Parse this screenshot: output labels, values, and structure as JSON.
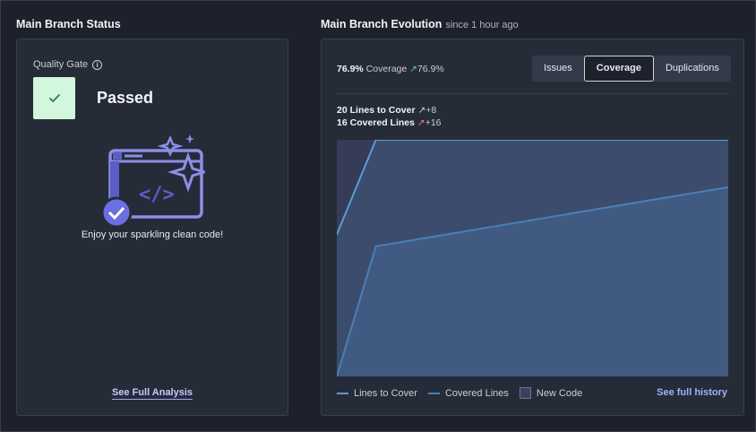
{
  "status": {
    "title": "Main Branch Status",
    "quality_gate_label": "Quality Gate",
    "quality_gate_status": "Passed",
    "clean_message": "Enjoy your sparkling clean code!",
    "see_full_analysis": "See Full Analysis"
  },
  "evolution": {
    "title": "Main Branch Evolution",
    "subtitle": "since 1 hour ago",
    "coverage_value": "76.9%",
    "coverage_label": "Coverage",
    "coverage_delta": "76.9%",
    "tabs": [
      {
        "label": "Issues",
        "active": false
      },
      {
        "label": "Coverage",
        "active": true
      },
      {
        "label": "Duplications",
        "active": false
      }
    ],
    "lines_to_cover_value": "20",
    "lines_to_cover_label": "Lines to Cover",
    "lines_to_cover_delta": "+8",
    "covered_lines_value": "16",
    "covered_lines_label": "Covered Lines",
    "covered_lines_delta": "+16",
    "legend": {
      "lines_to_cover": "Lines to Cover",
      "covered_lines": "Covered Lines",
      "new_code": "New Code"
    },
    "see_full_history": "See full history"
  },
  "chart_data": {
    "type": "area",
    "series": [
      {
        "name": "Lines to Cover",
        "values": [
          12,
          20,
          20
        ],
        "color": "#5b9bd5"
      },
      {
        "name": "Covered Lines",
        "values": [
          0,
          11,
          16
        ],
        "color": "#4a7fb8"
      }
    ],
    "x": [
      0,
      0.1,
      1
    ],
    "ylim": [
      0,
      20
    ],
    "new_code_shaded": true
  },
  "colors": {
    "accent": "#9fb2fb",
    "passed_bg": "#d3f7dd",
    "passed_check": "#2f7a49",
    "panel_bg": "#262b38"
  }
}
